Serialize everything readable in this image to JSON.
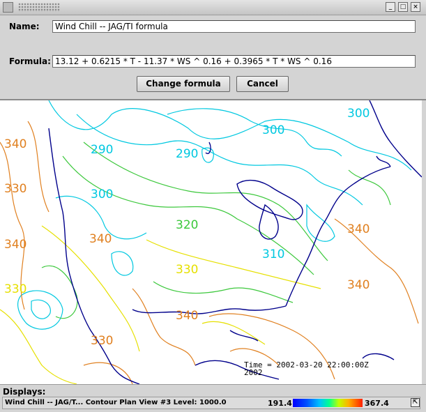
{
  "dialog": {
    "name_label": "Name:",
    "name_value": "Wind Chill -- JAG/TI formula",
    "formula_label": "Formula:",
    "formula_value": "13.12 + 0.6215 * T  -  11.37 * WS ^ 0.16  +  0.3965 * T * WS ^ 0.16",
    "change_button": "Change formula",
    "cancel_button": "Cancel",
    "window_controls": [
      "minimize-icon",
      "maximize-icon",
      "close-icon"
    ]
  },
  "map": {
    "contour_labels": [
      "340",
      "330",
      "340",
      "330",
      "290",
      "290",
      "300",
      "300",
      "300",
      "320",
      "340",
      "330",
      "310",
      "340",
      "340",
      "340",
      "330"
    ],
    "timestamp_line1": "Time = 2002-03-20 22:00:00Z",
    "timestamp_line2": "2002",
    "colors": {
      "coast": "#00008b",
      "cyan": "#00c8e0",
      "green": "#3cc83c",
      "yellow": "#e6e000",
      "orange": "#e08020"
    }
  },
  "displays": {
    "heading": "Displays:",
    "layer_label": "Wind Chill -- JAG/T...  Contour Plan View #3 Level: 1000.0",
    "range_min": "191.4",
    "range_max": "367.4"
  }
}
